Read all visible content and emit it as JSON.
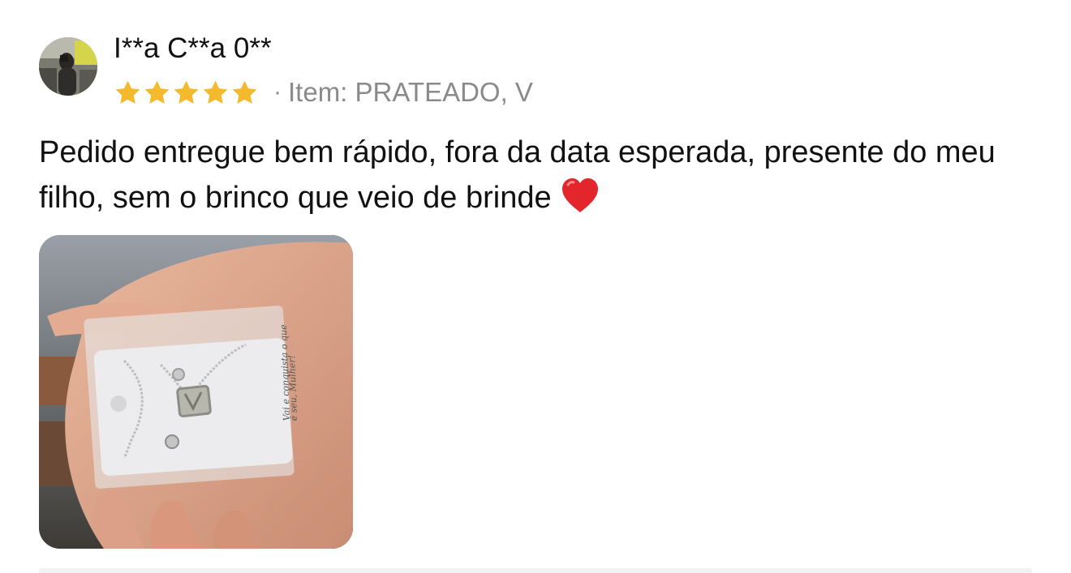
{
  "review": {
    "reviewer_name": "I**a C**a 0**",
    "rating": 5,
    "rating_max": 5,
    "separator": "·",
    "variant_label": "Item: PRATEADO, V",
    "text": "Pedido entregue bem rápido, fora da data esperada, presente do meu filho, sem o brinco que veio de brinde",
    "emoji_icon": "red-heart-icon",
    "photo_card_text": "Vai e conquista o que é seu, Mulher!",
    "star_color": "#F5B92E"
  }
}
